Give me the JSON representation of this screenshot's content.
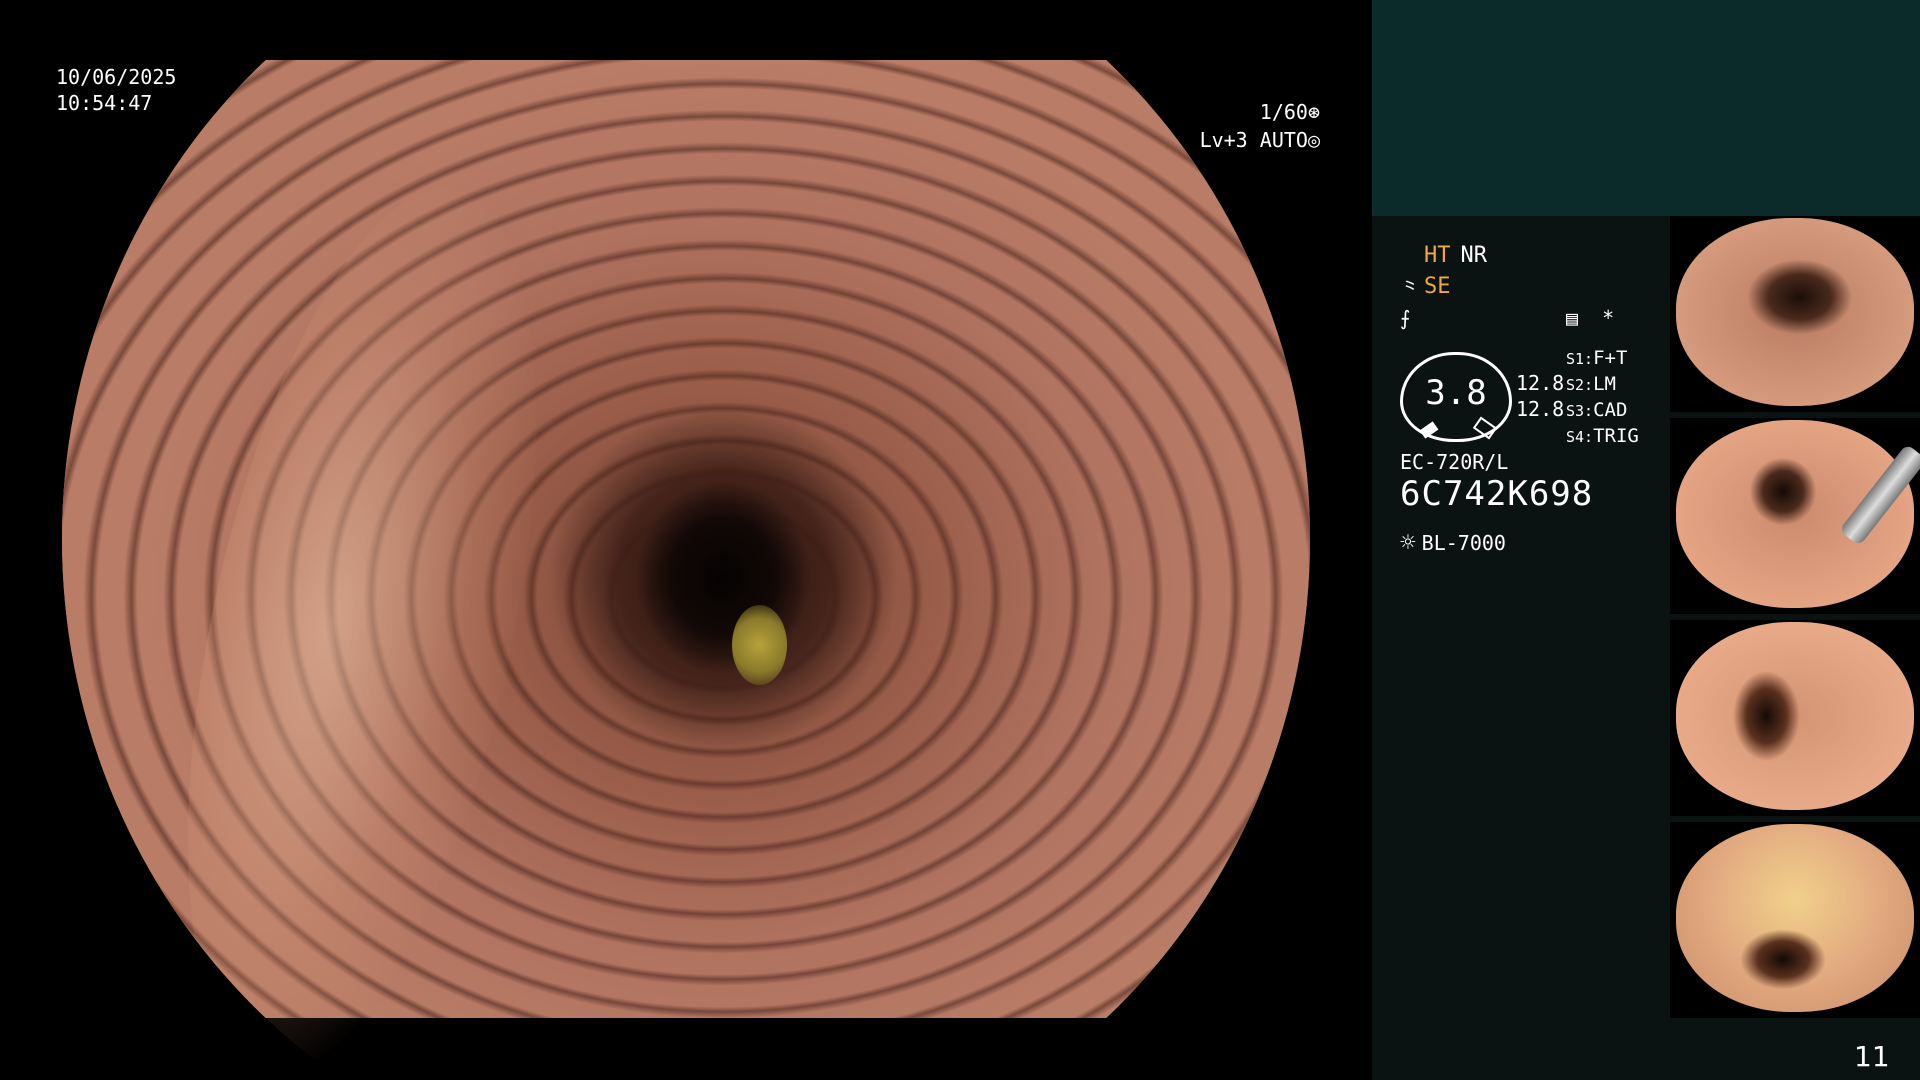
{
  "osd": {
    "date": "10/06/2025",
    "time": "10:54:47",
    "shutter": "1/60",
    "shutter_icon": "⊛",
    "level": "Lv+3",
    "mode": "AUTO",
    "mode_icon": "◎"
  },
  "info": {
    "ht": "HT",
    "nr": "NR",
    "se_icon": "⺀",
    "se": "SE",
    "freeze_icon": "⨍",
    "gauge_value": "3.8",
    "gauge_side_top": "12.8",
    "gauge_side_bottom": "12.8",
    "mode_icon_1": "▤",
    "mode_icon_2": "*",
    "switches": [
      {
        "key": "S1:",
        "value": "F+T"
      },
      {
        "key": "S2:",
        "value": "LM"
      },
      {
        "key": "S3:",
        "value": "CAD"
      },
      {
        "key": "S4:",
        "value": "TRIG"
      }
    ],
    "scope_model": "EC-720R/L",
    "scope_serial": "6C742K698",
    "light_icon": "☼",
    "light_source": "BL-7000"
  },
  "thumbnails": [
    {
      "label": "thumbnail-1"
    },
    {
      "label": "thumbnail-2"
    },
    {
      "label": "thumbnail-3"
    },
    {
      "label": "thumbnail-4"
    }
  ],
  "page_number": "11",
  "colors": {
    "accent_orange": "#f2a93b",
    "panel_top": "#0b2a2a",
    "panel_body": "#0b1212"
  }
}
